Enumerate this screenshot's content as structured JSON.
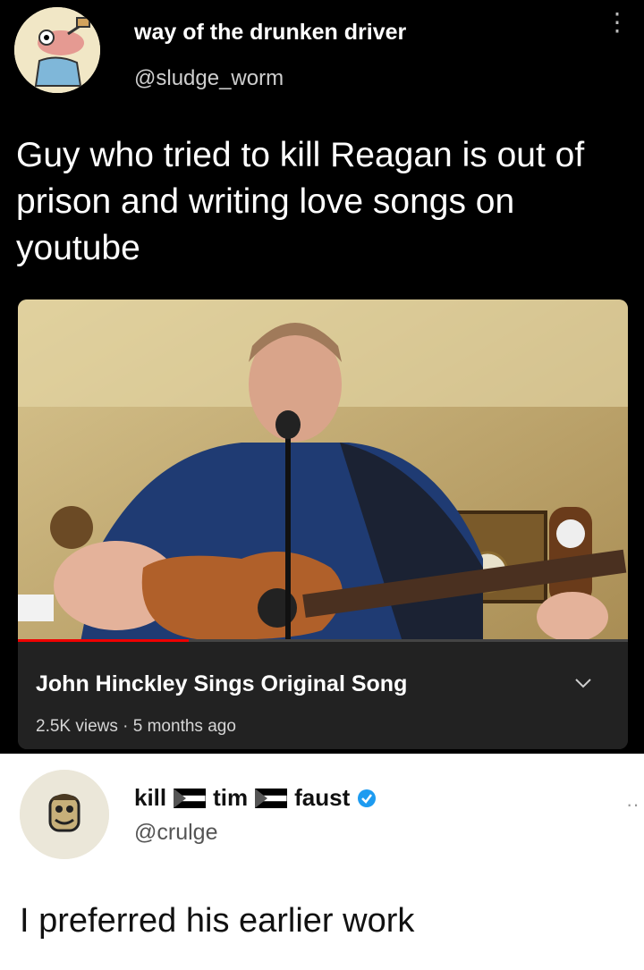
{
  "original_post": {
    "display_name": "way of the drunken driver",
    "handle": "@sludge_worm",
    "text": "Guy who tried to kill Reagan is out of prison and writing love songs on youtube",
    "more_icon": "vertical-dots-icon"
  },
  "video": {
    "title": "John Hinckley Sings Original Song",
    "views_line": "2.5K views · 5 months ago",
    "progress": 0.28,
    "expand_icon": "chevron-down-icon"
  },
  "reply": {
    "name_parts": [
      "kill",
      "tim",
      "faust"
    ],
    "flag_icon": "palestine-flag-icon",
    "verified_icon": "verified-badge-icon",
    "handle": "@crulge",
    "text": "I preferred his earlier work"
  },
  "colors": {
    "accent_verified": "#1d9bf0",
    "progress": "#e00000"
  }
}
